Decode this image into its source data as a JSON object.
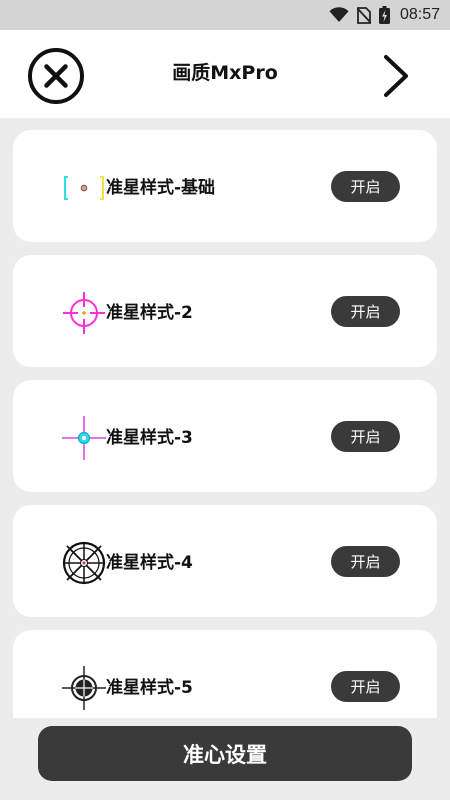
{
  "status_bar": {
    "time": "08:57",
    "icons": [
      "wifi-icon",
      "no-sim-icon",
      "battery-charging-icon"
    ]
  },
  "header": {
    "title": "画质MxPro",
    "close_icon": "close-circle-icon",
    "next_icon": "chevron-right-icon"
  },
  "crosshair_styles": [
    {
      "label": "准星样式-基础",
      "button": "开启",
      "icon": "crosshair-basic-icon"
    },
    {
      "label": "准星样式-2",
      "button": "开启",
      "icon": "crosshair-circle-magenta-icon"
    },
    {
      "label": "准星样式-3",
      "button": "开启",
      "icon": "crosshair-cross-cyan-icon"
    },
    {
      "label": "准星样式-4",
      "button": "开启",
      "icon": "crosshair-scope-icon"
    },
    {
      "label": "准星样式-5",
      "button": "开启",
      "icon": "crosshair-target-icon"
    }
  ],
  "bottom": {
    "settings_button": "准心设置"
  },
  "colors": {
    "background": "#ececec",
    "card": "#ffffff",
    "button_dark": "#3a3a3a",
    "status_bar": "#d4d4d4"
  }
}
